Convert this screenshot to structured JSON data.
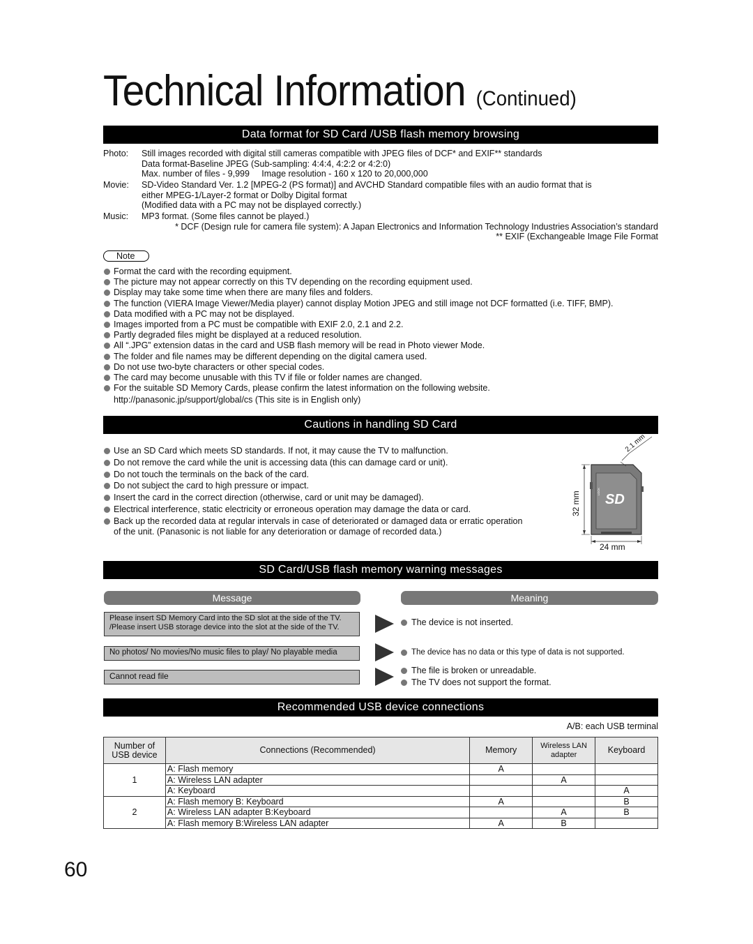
{
  "page": {
    "title": "Technical Information",
    "title_suffix": "(Continued)",
    "page_number": "60"
  },
  "sections": {
    "data_format": {
      "heading": "Data format for SD Card /USB flash memory browsing",
      "rows": [
        {
          "label": "Photo:",
          "lines": [
            "Still images recorded with digital still cameras compatible with JPEG files of DCF* and EXIF** standards",
            "Data format-Baseline JPEG (Sub-sampling: 4:4:4, 4:2:2 or 4:2:0)",
            "Max. number of files - 9,999     Image resolution - 160 x 120 to 20,000,000"
          ]
        },
        {
          "label": "Movie:",
          "lines": [
            "SD-Video Standard Ver. 1.2 [MPEG-2 (PS format)] and AVCHD Standard compatible files with an audio format that is",
            "either MPEG-1/Layer-2 format or Dolby Digital format",
            "(Modified data with a PC may not be displayed correctly.)"
          ]
        },
        {
          "label": "Music:",
          "lines": [
            "MP3 format. (Some files cannot be played.)"
          ]
        }
      ],
      "footnote_dcf": "* DCF (Design rule for camera file system):  A Japan Electronics and Information Technology Industries Association’s standard",
      "footnote_exif": "** EXIF (Exchangeable Image File Format",
      "note_label": "Note",
      "notes": [
        "Format the card with the recording equipment.",
        "The picture may not appear correctly on this TV depending on the recording equipment used.",
        "Display may take some time when there are many files and folders.",
        "The function (VIERA Image Viewer/Media player) cannot display Motion JPEG and still image not DCF formatted (i.e. TIFF, BMP).",
        "Data modified with a PC may not be displayed.",
        "Images imported from a PC must be compatible with EXIF 2.0, 2.1 and 2.2.",
        "Partly degraded files might be displayed at a reduced resolution.",
        "All “.JPG” extension datas in the card and USB flash memory will be read in Photo viewer Mode.",
        "The folder and file names may be different depending on the digital camera used.",
        "Do not use two-byte characters or other special codes.",
        "The card may become unusable with this TV if file or folder names are changed.",
        "For the suitable SD Memory Cards, please confirm the latest information on the following website."
      ],
      "website_line": "http://panasonic.jp/support/global/cs (This site is in English only)"
    },
    "cautions": {
      "heading": "Cautions in handling SD Card",
      "items": [
        "Use an SD Card which meets SD standards. If not, it may cause the TV to malfunction.",
        "Do not remove the card while the unit is accessing data (this can damage card or unit).",
        "Do not touch the terminals on the back of the card.",
        "Do not subject the card to high pressure or impact.",
        "Insert the card in the correct direction (otherwise, card or unit may be damaged).",
        "Electrical interference, static electricity or erroneous operation may damage the data or card.",
        "Back up the recorded data at regular intervals in case of deteriorated or damaged data or erratic operation"
      ],
      "last_item_cont": "of the unit. (Panasonic is not liable for any deterioration or damage of recorded data.)",
      "card_diagram": {
        "thickness": "2.1 mm",
        "height": "32 mm",
        "width": "24 mm",
        "logo": "SD",
        "lock_label": "LOCK"
      }
    },
    "warnings": {
      "heading": "SD Card/USB flash memory warning messages",
      "message_header": "Message",
      "meaning_header": "Meaning",
      "rows": [
        {
          "message_lines": [
            "Please insert SD Memory Card into the SD slot at the side of the TV.",
            "/Please insert USB storage device into the slot at the side of the TV."
          ],
          "meanings": [
            "The device is not inserted."
          ]
        },
        {
          "message_lines": [
            "No photos/ No movies/No music files to play/ No playable media"
          ],
          "meanings": [
            "The device has no data or this type of data is not supported."
          ]
        },
        {
          "message_lines": [
            "Cannot read file"
          ],
          "meanings": [
            "The file is broken or unreadable.",
            "The TV does not support the format."
          ]
        }
      ]
    },
    "usb": {
      "heading": "Recommended USB device connections",
      "legend": "A/B: each USB terminal",
      "columns": {
        "number_line1": "Number of",
        "number_line2": "USB device",
        "connections": "Connections (Recommended)",
        "memory": "Memory",
        "wireless_line1": "Wireless LAN",
        "wireless_line2": "adapter",
        "keyboard": "Keyboard"
      },
      "groups": [
        {
          "number": "1",
          "rows": [
            {
              "conn": "A: Flash memory",
              "memory": "A",
              "wireless": "",
              "keyboard": ""
            },
            {
              "conn": "A: Wireless LAN adapter",
              "memory": "",
              "wireless": "A",
              "keyboard": ""
            },
            {
              "conn": "A: Keyboard",
              "memory": "",
              "wireless": "",
              "keyboard": "A"
            }
          ]
        },
        {
          "number": "2",
          "rows": [
            {
              "conn": "A: Flash memory  B: Keyboard",
              "memory": "A",
              "wireless": "",
              "keyboard": "B"
            },
            {
              "conn": "A: Wireless LAN adapter  B:Keyboard",
              "memory": "",
              "wireless": "A",
              "keyboard": "B"
            },
            {
              "conn": "A: Flash memory  B:Wireless LAN adapter",
              "memory": "A",
              "wireless": "B",
              "keyboard": ""
            }
          ]
        }
      ]
    }
  }
}
